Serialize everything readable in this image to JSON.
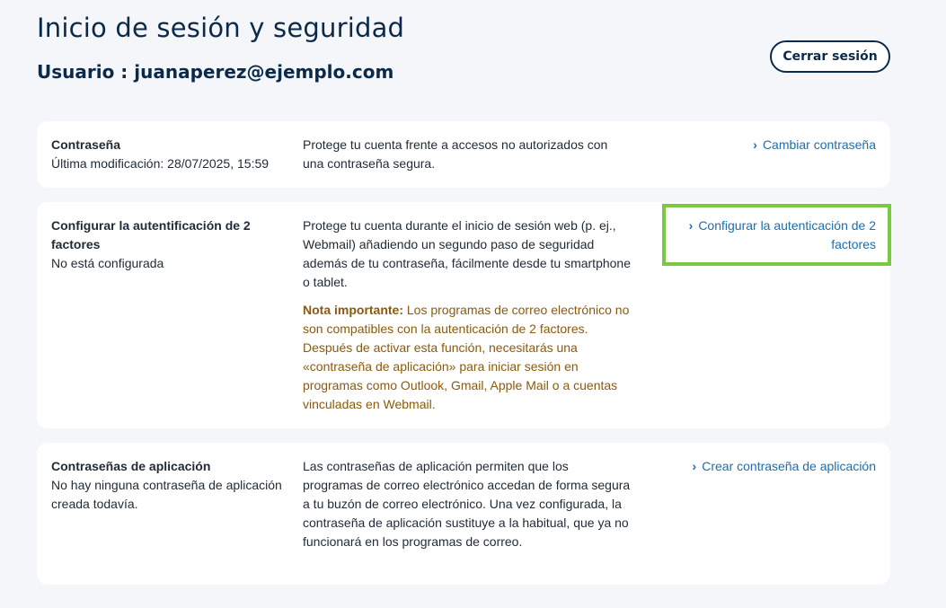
{
  "header": {
    "title": "Inicio de sesión y seguridad",
    "user_line": "Usuario : juanaperez@ejemplo.com",
    "logout_label": "Cerrar sesión"
  },
  "cards": {
    "password": {
      "label": "Contraseña",
      "status": "Última modificación: 28/07/2025, 15:59",
      "description": "Protege tu cuenta frente a accesos no autorizados con una contraseña segura.",
      "action": "Cambiar contraseña"
    },
    "two_factor": {
      "label": "Configurar la autentificación de 2 factores",
      "status": "No está configurada",
      "description": "Protege tu cuenta durante el inicio de sesión web (p. ej., Webmail) añadiendo un segundo paso de seguridad además de tu contraseña, fácilmente desde tu smartphone o tablet.",
      "note_label": "Nota importante:",
      "note_text": " Los programas de correo electrónico no son compatibles con la autenticación de 2 factores. Después de activar esta función, necesitarás una «contraseña de aplicación» para iniciar sesión en programas como Outlook, Gmail, Apple Mail o a cuentas vinculadas en Webmail.",
      "action": "Configurar la autenticación de 2 factores"
    },
    "app_passwords": {
      "label": "Contraseñas de aplicación",
      "status": "No hay ninguna contraseña de aplicación creada todavía.",
      "description": "Las contraseñas de aplicación permiten que los programas de correo electrónico accedan de forma segura a tu buzón de correo electrónico. Una vez configurada, la contraseña de aplicación sustituye a la habitual, que ya no funcionará en los programas de correo.",
      "action": "Crear contraseña de aplicación"
    }
  },
  "colors": {
    "background": "#f4f6f9",
    "heading": "#0b2a4a",
    "link": "#1a6fb0",
    "note": "#8a5a0c",
    "highlight": "#7ac943"
  },
  "icons": {
    "link_chevron": "chevron-right-icon"
  }
}
